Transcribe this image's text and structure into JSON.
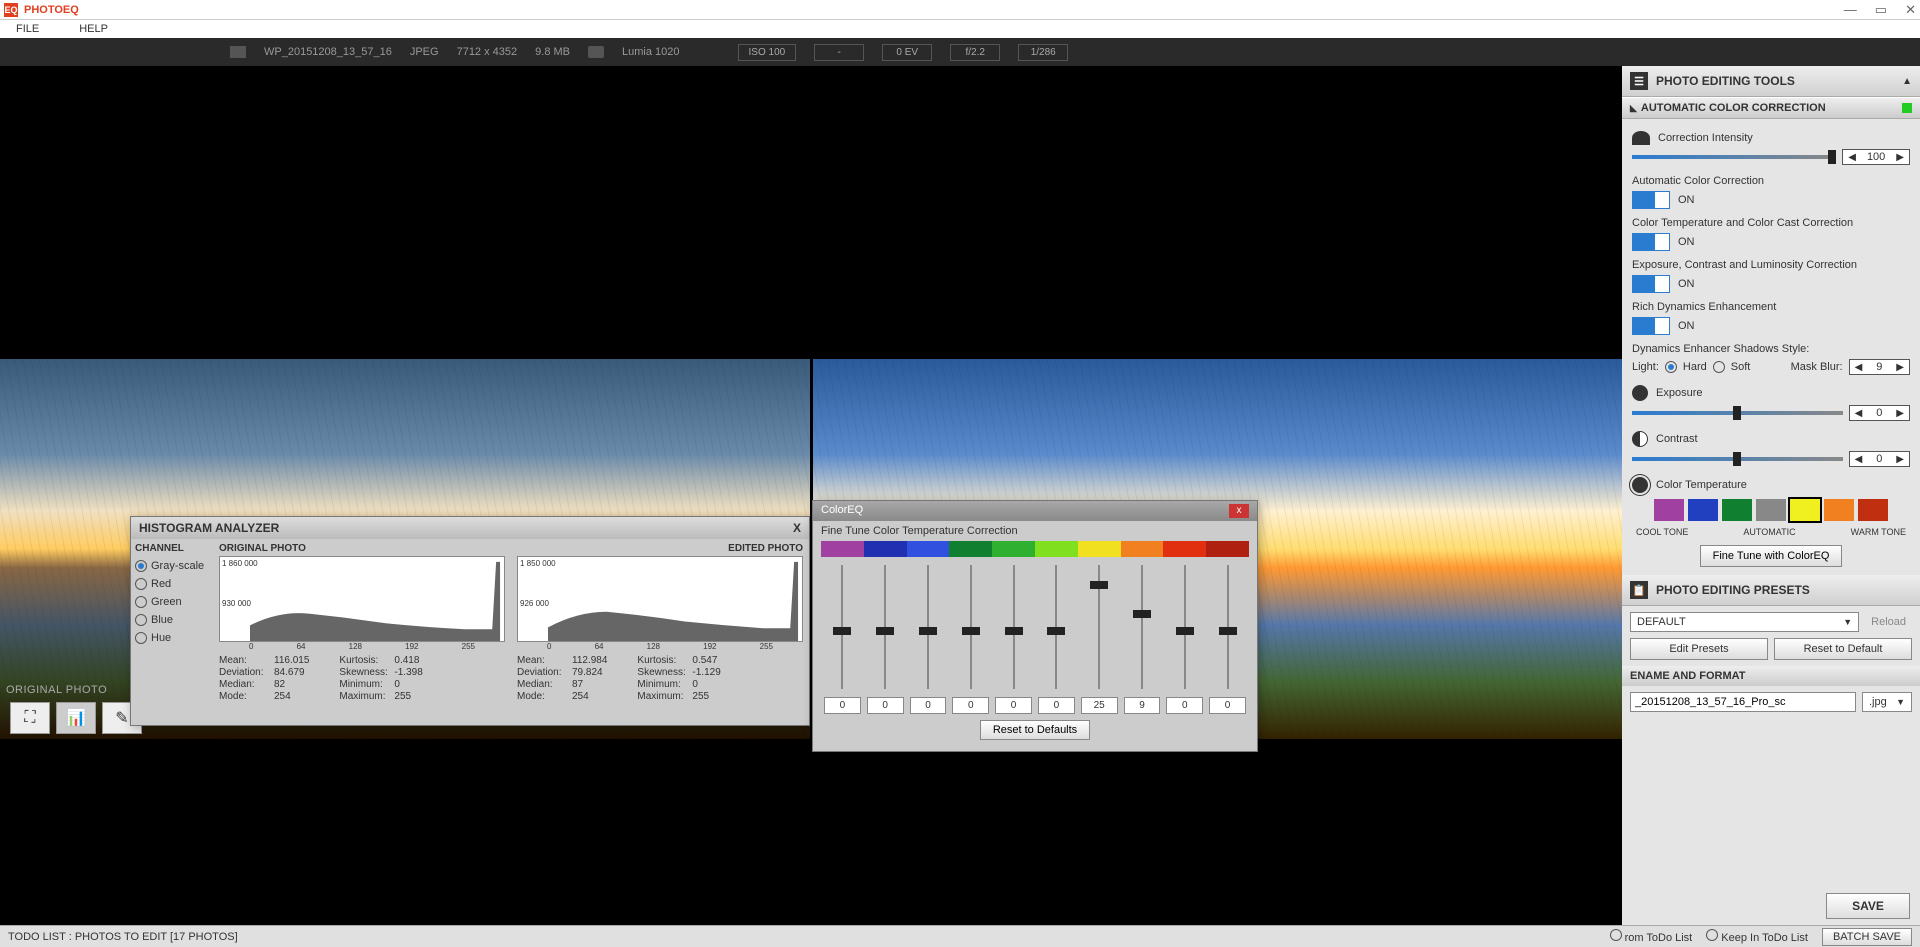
{
  "app": {
    "title": "PHOTOEQ"
  },
  "menu": {
    "file": "FILE",
    "help": "HELP"
  },
  "info": {
    "filename": "WP_20151208_13_57_16",
    "format": "JPEG",
    "dimensions": "7712 x 4352",
    "size": "9.8 MB",
    "camera": "Lumia 1020",
    "iso": "ISO 100",
    "dash": "-",
    "ev": "0 EV",
    "aperture": "f/2.2",
    "shutter": "1/286"
  },
  "viewer": {
    "original_label": "ORIGINAL PHOTO"
  },
  "tools": {
    "header": "PHOTO EDITING TOOLS",
    "acc": {
      "title": "AUTOMATIC COLOR CORRECTION",
      "intensity_label": "Correction Intensity",
      "intensity_value": "100",
      "auto_label": "Automatic Color Correction",
      "temp_label": "Color Temperature and Color Cast Correction",
      "exp_label": "Exposure, Contrast and Luminosity Correction",
      "rich_label": "Rich Dynamics Enhancement",
      "on": "ON",
      "dyn_label": "Dynamics Enhancer Shadows Style:",
      "light": "Light:",
      "hard": "Hard",
      "soft": "Soft",
      "maskblur": "Mask Blur:",
      "maskblur_val": "9",
      "exposure": "Exposure",
      "exposure_val": "0",
      "contrast": "Contrast",
      "contrast_val": "0",
      "colortemp": "Color Temperature",
      "cool": "COOL TONE",
      "auto_tone": "AUTOMATIC",
      "warm": "WARM TONE",
      "finetune": "Fine Tune with ColorEQ"
    },
    "presets": {
      "title": "PHOTO EDITING PRESETS",
      "default": "DEFAULT",
      "reload": "Reload",
      "edit": "Edit Presets",
      "reset": "Reset to Default"
    },
    "save": {
      "header": "ENAME AND FORMAT",
      "filename": "_20151208_13_57_16_Pro_sc",
      "ext": ".jpg",
      "save": "SAVE"
    }
  },
  "bottom": {
    "todo": "TODO LIST : PHOTOS TO EDIT  [17 PHOTOS]",
    "remove": "rom ToDo List",
    "keep": "Keep In ToDo List",
    "batch": "BATCH SAVE"
  },
  "hist": {
    "title": "HISTOGRAM ANALYZER",
    "channel": "CHANNEL",
    "gray": "Gray-scale",
    "red": "Red",
    "green": "Green",
    "blue": "Blue",
    "hue": "Hue",
    "original": "ORIGINAL PHOTO",
    "edited": "EDITED PHOTO",
    "y1_orig": "1 860 000",
    "y2_orig": "930 000",
    "y1_edit": "1 850 000",
    "y2_edit": "926 000",
    "xticks": [
      "0",
      "64",
      "128",
      "192",
      "255"
    ],
    "orig_stats": {
      "mean": "116.015",
      "dev": "84.679",
      "median": "82",
      "mode": "254",
      "kurt": "0.418",
      "skew": "-1.398",
      "min": "0",
      "max": "255"
    },
    "edit_stats": {
      "mean": "112.984",
      "dev": "79.824",
      "median": "87",
      "mode": "254",
      "kurt": "0.547",
      "skew": "-1.129",
      "min": "0",
      "max": "255"
    },
    "labels": {
      "mean": "Mean:",
      "dev": "Deviation:",
      "median": "Median:",
      "mode": "Mode:",
      "kurt": "Kurtosis:",
      "skew": "Skewness:",
      "min": "Minimum:",
      "max": "Maximum:"
    }
  },
  "ceq": {
    "title": "ColorEQ",
    "sub": "Fine Tune Color Temperature Correction",
    "colors": [
      "#a040a0",
      "#2030b0",
      "#3050e0",
      "#108030",
      "#30b030",
      "#80e020",
      "#f0e020",
      "#f08020",
      "#e03010",
      "#b02010"
    ],
    "values": [
      "0",
      "0",
      "0",
      "0",
      "0",
      "0",
      "25",
      "9",
      "0",
      "0"
    ],
    "reset": "Reset to Defaults"
  },
  "color_swatches": [
    "#a040a0",
    "#2040c0",
    "#108030",
    "#888",
    "#f0f020",
    "#f08020",
    "#c03010"
  ]
}
